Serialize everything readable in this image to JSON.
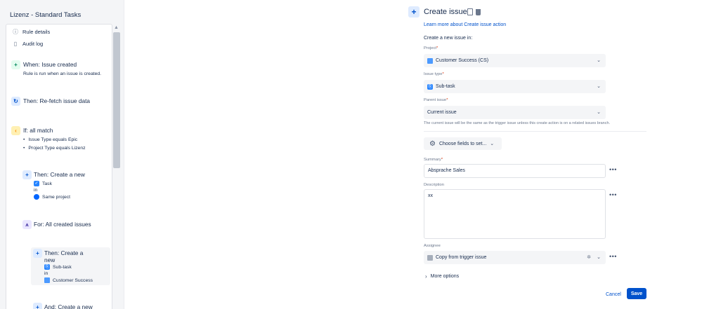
{
  "left": {
    "title": "Lizenz - Standard Tasks",
    "links": [
      {
        "label": "Rule details",
        "icon": "info-icon"
      },
      {
        "label": "Audit log",
        "icon": "document-icon"
      }
    ],
    "trigger": {
      "title": "When: Issue created",
      "sub": "Rule is run when an issue is created."
    },
    "refetch": {
      "title": "Then: Re-fetch issue data"
    },
    "condition": {
      "title": "If: all match",
      "bullets": [
        "Issue Type equals Epic",
        "Project Type equals Lizenz"
      ]
    },
    "create1": {
      "title": "Then: Create a new",
      "type": "Task",
      "in": "in",
      "project": "Same project"
    },
    "for_each": {
      "title": "For: All created issues"
    },
    "create2": {
      "title_line1": "Then: Create a",
      "title_line2": "new",
      "type": "Sub-task",
      "in": "in",
      "project": "Customer Success"
    },
    "create3": {
      "title": "And: Create a new"
    }
  },
  "right": {
    "title": "Create issue",
    "learn_link": "Learn more about Create issue action",
    "intro": "Create a new issue in:",
    "project": {
      "label": "Project",
      "value": "Customer Success (CS)"
    },
    "issue_type": {
      "label": "Issue type",
      "value": "Sub-task"
    },
    "parent": {
      "label": "Parent issue",
      "value": "Current issue",
      "helper": "The current issue will be the same as the trigger issue unless this create action is on a related issues branch."
    },
    "choose_fields": "Choose fields to set...",
    "summary": {
      "label": "Summary",
      "value": "Absprache Sales"
    },
    "description": {
      "label": "Description",
      "value": "xx"
    },
    "assignee": {
      "label": "Assignee",
      "value": "Copy from trigger issue"
    },
    "more_options": "More options",
    "cancel": "Cancel",
    "save": "Save",
    "required_mark": "*",
    "dots": "•••"
  },
  "colors": {
    "accent": "#0052cc",
    "required": "#de350b",
    "panel_bg": "#f4f5f7"
  }
}
